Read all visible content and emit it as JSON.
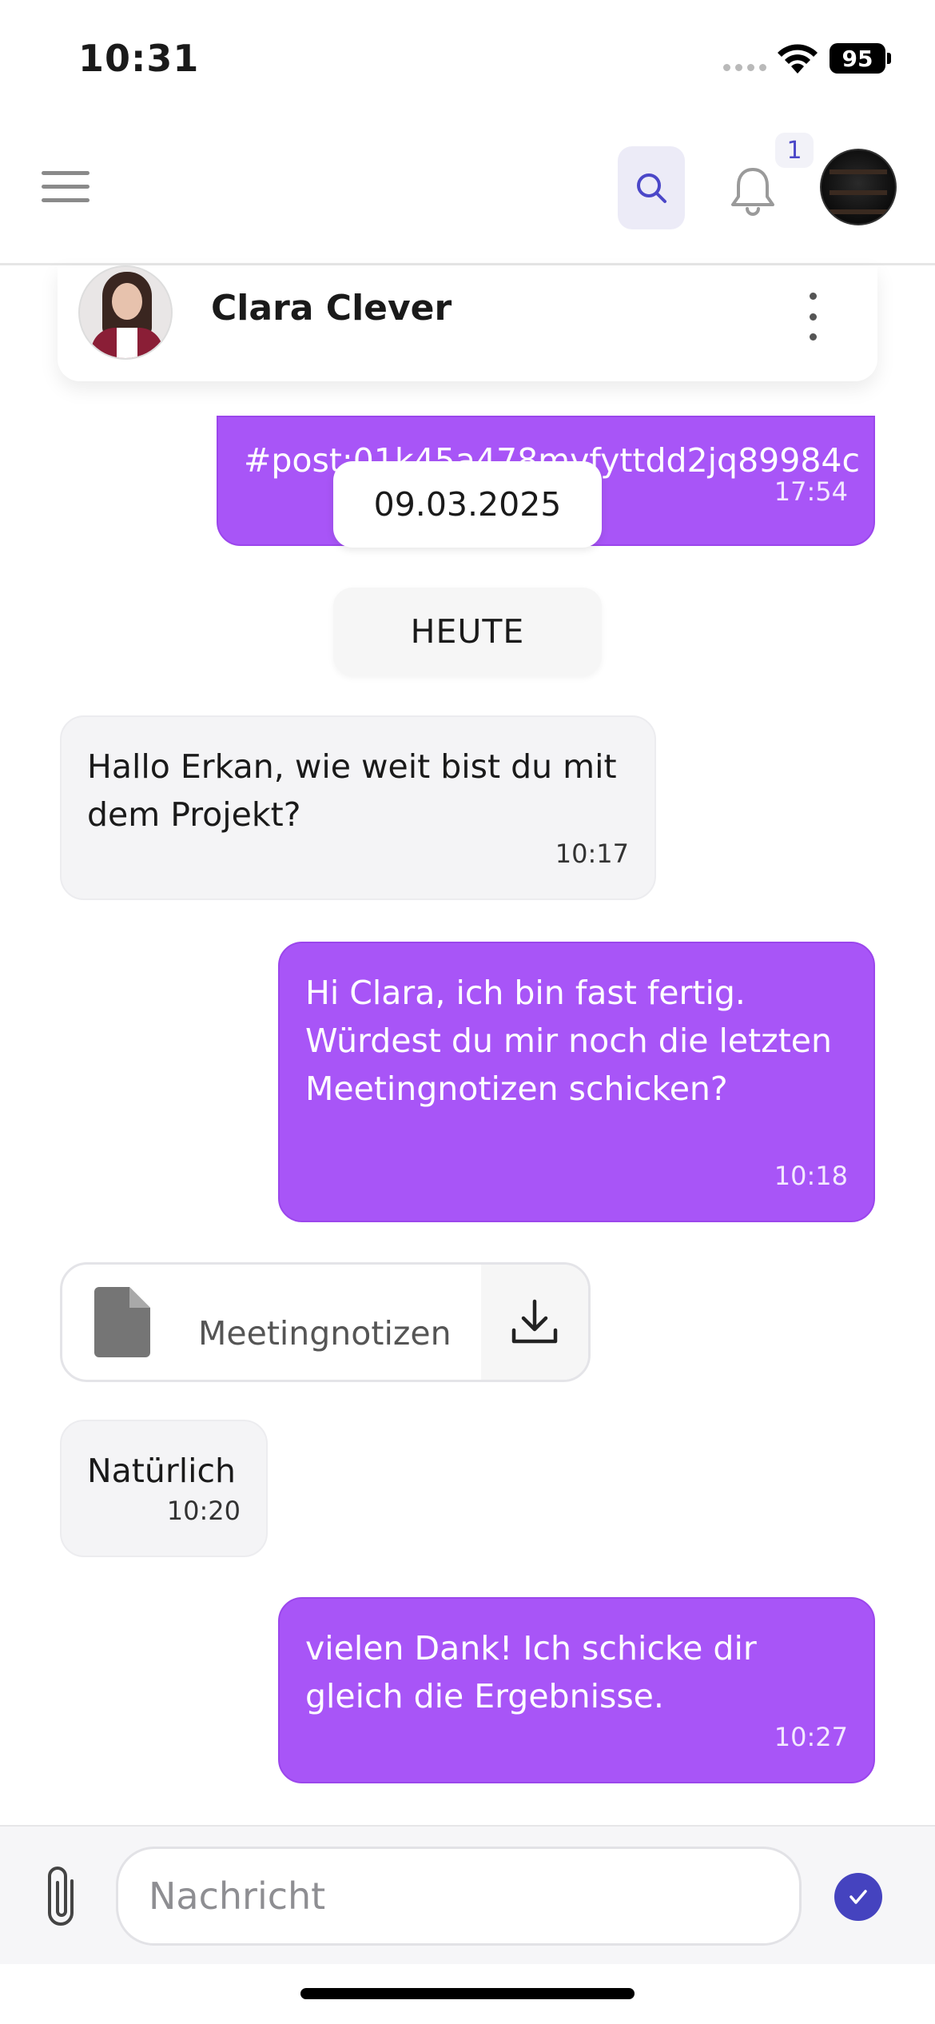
{
  "status_bar": {
    "time": "10:31",
    "battery": "95"
  },
  "header": {
    "notification_count": "1"
  },
  "contact": {
    "name": "Clara Clever"
  },
  "chat": {
    "partial_message": {
      "text": "#post:01k45a478mvfyttdd2jq89984c",
      "time": "17:54"
    },
    "date_chip": "09.03.2025",
    "today_chip": "HEUTE",
    "messages": [
      {
        "text": "Hallo Erkan, wie weit bist du mit dem Projekt?",
        "time": "10:17"
      },
      {
        "text": "Hi Clara, ich bin fast fertig. Würdest du mir noch die letzten Meetingnotizen schicken?",
        "time": "10:18"
      },
      {
        "text": "Natürlich",
        "time": "10:20"
      },
      {
        "text": "vielen Dank! Ich schicke dir gleich die Ergebnisse.",
        "time": "10:27"
      }
    ],
    "file": {
      "name": "Meetingnotizen"
    }
  },
  "composer": {
    "placeholder": "Nachricht"
  },
  "colors": {
    "accent": "#a855f7",
    "send_button": "#4543bf",
    "badge_text": "#4b47c8"
  }
}
